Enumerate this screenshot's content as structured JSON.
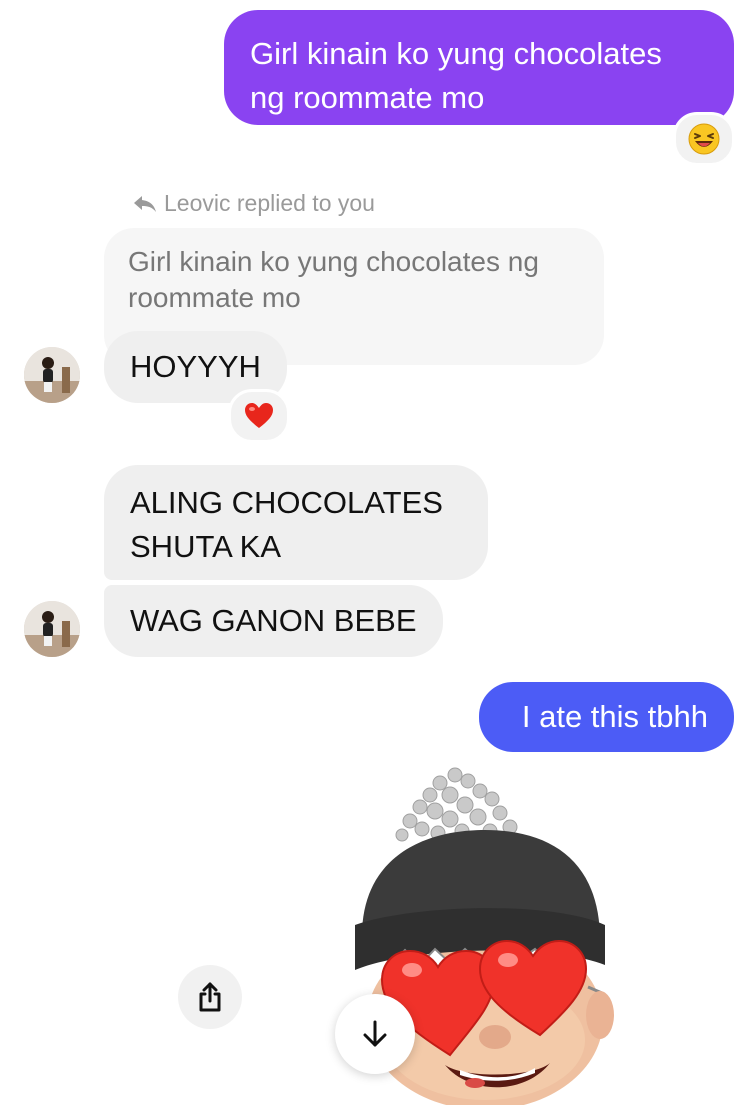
{
  "messages": {
    "sent_1": {
      "text_line1": "Girl kinain ko yung chocolates",
      "text_line2": "ng roommate mo",
      "reaction": "laughing-face"
    },
    "reply_label": "Leovic replied to you",
    "quoted": {
      "line1": "Girl kinain ko yung chocolates ng",
      "line2": "roommate mo"
    },
    "recv_1": {
      "text": "HOYYYH",
      "reaction": "red-heart"
    },
    "recv_2": {
      "line1": "ALING CHOCOLATES",
      "line2": "SHUTA KA"
    },
    "recv_3": {
      "text": "WAG GANON BEBE"
    },
    "sent_2": {
      "text": "I ate this tbhh"
    },
    "memoji": {
      "description": "memoji-sticker-heart-eyes"
    }
  },
  "controls": {
    "share": "share-icon",
    "scroll_down": "arrow-down-icon"
  },
  "colors": {
    "sent_purple": "#8a43f1",
    "sent_blue": "#4c5cf6",
    "received": "#efefef"
  }
}
